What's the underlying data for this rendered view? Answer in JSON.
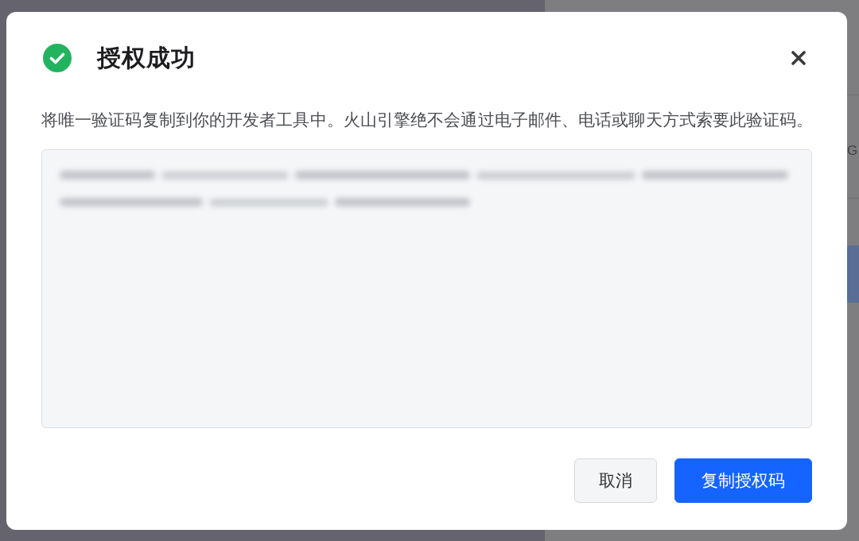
{
  "background": {
    "text_fragment": "G"
  },
  "dialog": {
    "title": "授权成功",
    "description": "将唯一验证码复制到你的开发者工具中。火山引擎绝不会通过电子邮件、电话或聊天方式索要此验证码。",
    "buttons": [
      {
        "label": "取消",
        "kind": "secondary"
      },
      {
        "label": "复制授权码",
        "kind": "primary"
      }
    ]
  }
}
